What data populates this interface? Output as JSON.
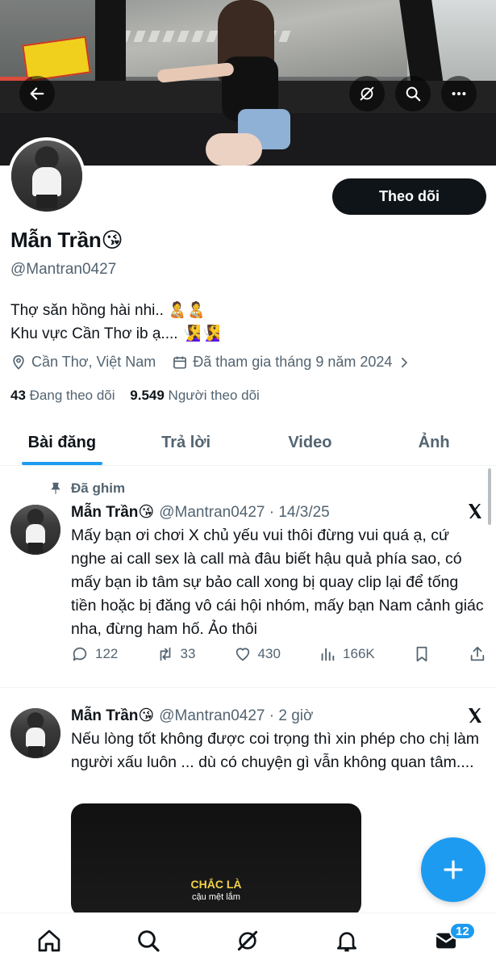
{
  "profile": {
    "display_name": "Mẫn Trần",
    "name_emoji": "😘",
    "handle": "@Mantran0427",
    "bio_line1": "Thợ săn hồng hài nhi.. 🧑‍🍼🧑‍🍼",
    "bio_line2": "Khu vực Cần Thơ ib ạ.... 🧏‍♀️🧏‍♀️",
    "location": "Cần Thơ, Việt Nam",
    "joined": "Đã tham gia tháng 9 năm 2024",
    "following_count": "43",
    "following_label": "Đang theo dõi",
    "followers_count": "9.549",
    "followers_label": "Người theo dõi",
    "follow_button": "Theo dõi"
  },
  "header_icons": [
    "back-arrow-icon",
    "grok-icon",
    "search-icon",
    "more-icon"
  ],
  "tabs": [
    {
      "label": "Bài đăng",
      "active": true
    },
    {
      "label": "Trả lời",
      "active": false
    },
    {
      "label": "Video",
      "active": false
    },
    {
      "label": "Ảnh",
      "active": false
    }
  ],
  "posts": [
    {
      "pinned_label": "Đã ghim",
      "name": "Mẫn Trần😘",
      "handle_time": "@Mantran0427 · 14/3/25",
      "text": "Mấy bạn ơi chơi X chủ yếu vui thôi đừng vui quá ạ, cứ nghe ai call sex là call mà đâu biết hậu quả phía sao, có mấy bạn ib tâm sự bảo call xong bị quay clip lại để tống tiền hoặc bị đăng vô cái hội nhóm, mấy bạn Nam cảnh giác nha, đừng ham hố. Ảo thôi",
      "replies": "122",
      "reposts": "33",
      "likes": "430",
      "views": "166K"
    },
    {
      "name": "Mẫn Trần😘",
      "handle_time": "@Mantran0427 · 2 giờ",
      "text": "Nếu lòng tốt không được coi trọng thì xin phép cho chị làm người xấu luôn ... dù có chuyện gì vẫn không quan tâm....",
      "media_caption1": "CHẮC LÀ",
      "media_caption2": "cậu mệt lắm"
    }
  ],
  "bottom_nav": [
    "home-icon",
    "search-icon",
    "grok-icon",
    "notifications-icon",
    "messages-icon"
  ],
  "messages_badge": "12",
  "colors": {
    "accent": "#1d9bf0",
    "text": "#0f1419",
    "secondary": "#536471"
  }
}
